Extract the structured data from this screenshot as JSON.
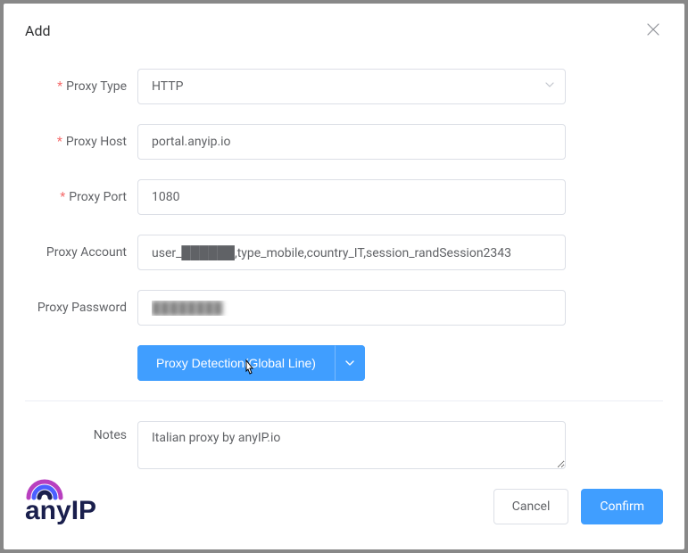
{
  "modal": {
    "title": "Add",
    "fields": {
      "proxy_type": {
        "label": "Proxy Type",
        "value": "HTTP"
      },
      "proxy_host": {
        "label": "Proxy Host",
        "value": "portal.anyip.io"
      },
      "proxy_port": {
        "label": "Proxy Port",
        "value": "1080"
      },
      "proxy_account": {
        "label": "Proxy Account",
        "value": "user_██████,type_mobile,country_IT,session_randSession2343"
      },
      "proxy_password": {
        "label": "Proxy Password",
        "value": "████████"
      },
      "notes": {
        "label": "Notes",
        "value": "Italian proxy by anyIP.io"
      }
    },
    "detect_button": "Proxy Detection(Global Line)",
    "footer": {
      "cancel": "Cancel",
      "confirm": "Confirm"
    }
  },
  "brand": {
    "name": "anyIP"
  }
}
